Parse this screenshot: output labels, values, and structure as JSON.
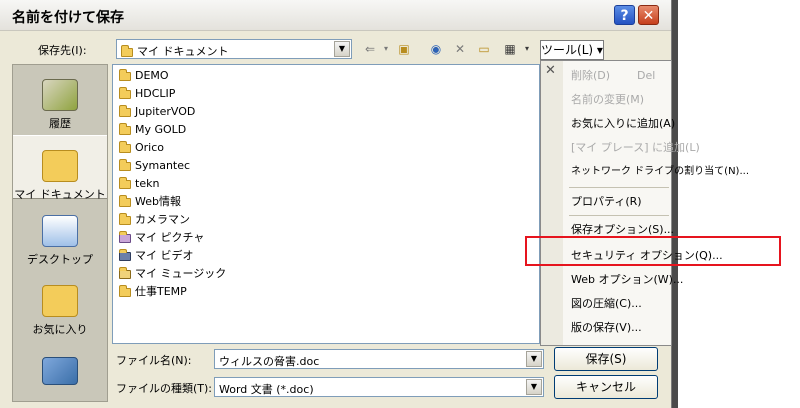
{
  "dialog": {
    "title": "名前を付けて保存",
    "help_label": "?",
    "close_label": "✕"
  },
  "location": {
    "label": "保存先(I):",
    "value": "マイ ドキュメント"
  },
  "toolbar": {
    "tools_menu_label": "ツール(L) ▾"
  },
  "places": [
    {
      "label": "履歴",
      "icon": "history-icon"
    },
    {
      "label": "マイ ドキュメント",
      "icon": "my-documents-icon"
    },
    {
      "label": "デスクトップ",
      "icon": "desktop-icon"
    },
    {
      "label": "お気に入り",
      "icon": "favorites-icon"
    }
  ],
  "files": [
    {
      "name": "DEMO",
      "icon": "folder-icon"
    },
    {
      "name": "HDCLIP",
      "icon": "folder-icon"
    },
    {
      "name": "JupiterVOD",
      "icon": "folder-icon"
    },
    {
      "name": "My GOLD",
      "icon": "folder-icon"
    },
    {
      "name": "Orico",
      "icon": "folder-icon"
    },
    {
      "name": "Symantec",
      "icon": "folder-icon"
    },
    {
      "name": "tekn",
      "icon": "folder-icon"
    },
    {
      "name": "Web情報",
      "icon": "folder-icon"
    },
    {
      "name": "カメラマン",
      "icon": "folder-icon"
    },
    {
      "name": "マイ ピクチャ",
      "icon": "my-pictures-icon"
    },
    {
      "name": "マイ ビデオ",
      "icon": "my-videos-icon"
    },
    {
      "name": "マイ ミュージック",
      "icon": "my-music-icon"
    },
    {
      "name": "仕事TEMP",
      "icon": "folder-icon"
    }
  ],
  "filename": {
    "label": "ファイル名(N):",
    "value": "ウィルスの脅害.doc"
  },
  "filetype": {
    "label": "ファイルの種類(T):",
    "value": "Word 文書 (*.doc)"
  },
  "buttons": {
    "save": "保存(S)",
    "cancel": "キャンセル"
  },
  "tools_menu": {
    "items": [
      {
        "label": "削除(D)",
        "shortcut": "Del",
        "disabled": true
      },
      {
        "label": "名前の変更(M)",
        "disabled": true
      },
      {
        "label": "お気に入りに追加(A)",
        "disabled": false
      },
      {
        "label": "[マイ プレース] に追加(L)",
        "disabled": true
      },
      {
        "label": "ネットワーク ドライブの割り当て(N)...",
        "disabled": false
      },
      {
        "label": "プロパティ(R)",
        "disabled": false
      },
      {
        "label": "保存オプション(S)...",
        "disabled": false
      },
      {
        "label": "セキュリティ オプション(Q)...",
        "disabled": false,
        "highlighted": true
      },
      {
        "label": "Web オプション(W)...",
        "disabled": false
      },
      {
        "label": "図の圧縮(C)...",
        "disabled": false
      },
      {
        "label": "版の保存(V)...",
        "disabled": false
      }
    ]
  },
  "colors": {
    "highlight_box": "#e6141e",
    "dialog_bg": "#ece9d8",
    "folder": "#f3cc5a"
  }
}
